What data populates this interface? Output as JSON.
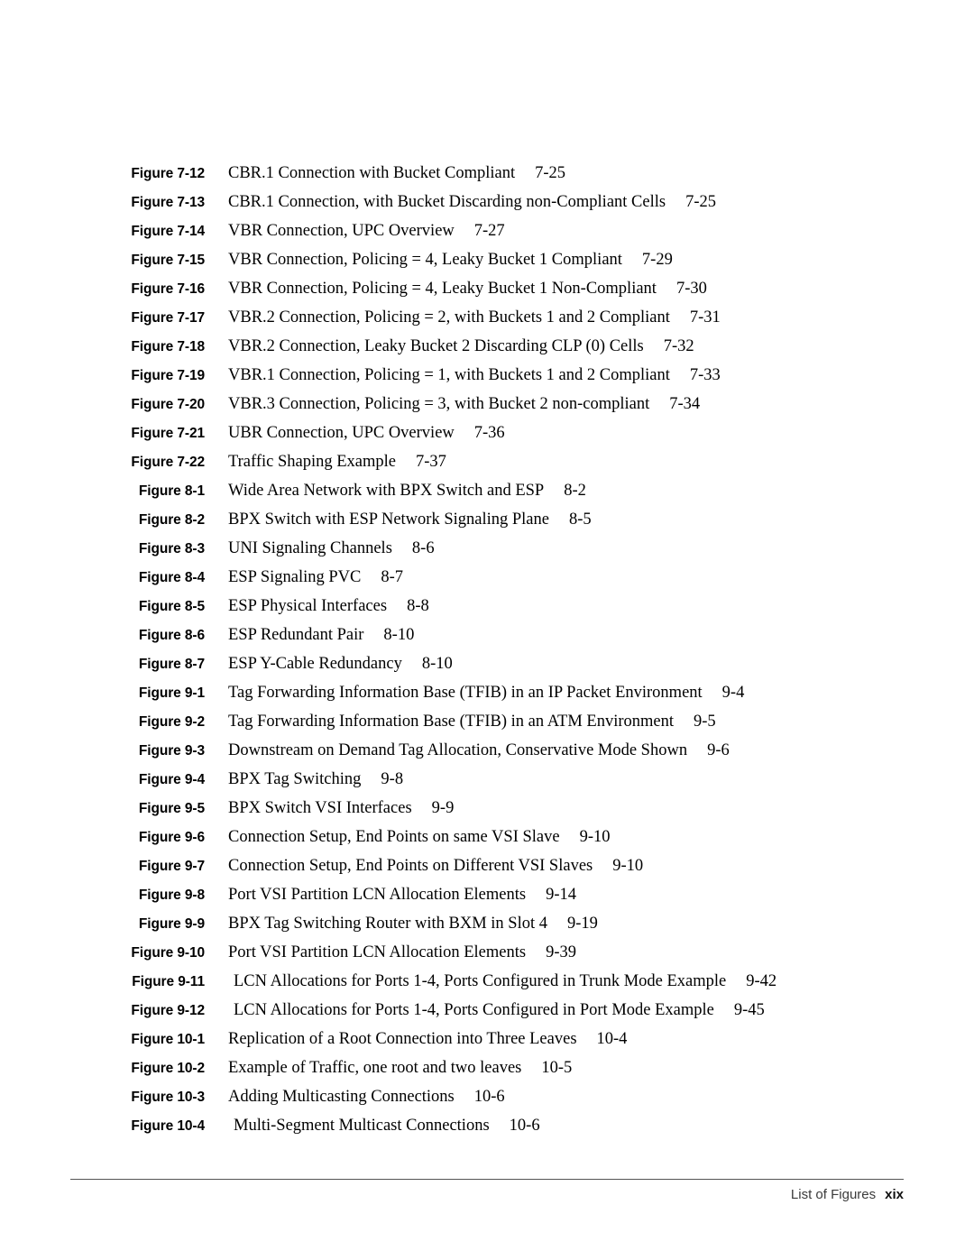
{
  "document": {
    "section_title": "List of Figures",
    "page_number": "xix"
  },
  "entries": [
    {
      "label": "Figure 7-12",
      "description": "CBR.1 Connection with Bucket Compliant",
      "page": "7-25",
      "indent": false
    },
    {
      "label": "Figure 7-13",
      "description": "CBR.1 Connection, with Bucket Discarding non-Compliant Cells",
      "page": "7-25",
      "indent": false
    },
    {
      "label": "Figure 7-14",
      "description": "VBR Connection, UPC Overview",
      "page": "7-27",
      "indent": false
    },
    {
      "label": "Figure 7-15",
      "description": "VBR Connection, Policing = 4, Leaky Bucket 1 Compliant",
      "page": "7-29",
      "indent": false
    },
    {
      "label": "Figure 7-16",
      "description": "VBR Connection, Policing = 4, Leaky Bucket 1 Non-Compliant",
      "page": "7-30",
      "indent": false
    },
    {
      "label": "Figure 7-17",
      "description": "VBR.2 Connection, Policing = 2, with Buckets 1 and 2 Compliant",
      "page": "7-31",
      "indent": false
    },
    {
      "label": "Figure 7-18",
      "description": "VBR.2 Connection, Leaky Bucket 2 Discarding CLP (0) Cells",
      "page": "7-32",
      "indent": false
    },
    {
      "label": "Figure 7-19",
      "description": "VBR.1 Connection, Policing = 1, with Buckets 1 and 2 Compliant",
      "page": "7-33",
      "indent": false
    },
    {
      "label": "Figure 7-20",
      "description": "VBR.3 Connection, Policing = 3, with Bucket 2 non-compliant",
      "page": "7-34",
      "indent": false
    },
    {
      "label": "Figure 7-21",
      "description": "UBR Connection, UPC Overview",
      "page": "7-36",
      "indent": false
    },
    {
      "label": "Figure 7-22",
      "description": "Traffic Shaping Example",
      "page": "7-37",
      "indent": false
    },
    {
      "label": "Figure 8-1",
      "description": "Wide Area Network with BPX Switch and ESP",
      "page": "8-2",
      "indent": false
    },
    {
      "label": "Figure 8-2",
      "description": "BPX Switch with ESP Network Signaling Plane",
      "page": "8-5",
      "indent": false
    },
    {
      "label": "Figure 8-3",
      "description": "UNI Signaling Channels",
      "page": "8-6",
      "indent": false
    },
    {
      "label": "Figure 8-4",
      "description": "ESP Signaling PVC",
      "page": "8-7",
      "indent": false
    },
    {
      "label": "Figure 8-5",
      "description": "ESP Physical Interfaces",
      "page": "8-8",
      "indent": false
    },
    {
      "label": "Figure 8-6",
      "description": "ESP Redundant Pair",
      "page": "8-10",
      "indent": false
    },
    {
      "label": "Figure 8-7",
      "description": "ESP Y-Cable Redundancy",
      "page": "8-10",
      "indent": false
    },
    {
      "label": "Figure 9-1",
      "description": "Tag Forwarding Information Base (TFIB) in an IP Packet Environment",
      "page": "9-4",
      "indent": false
    },
    {
      "label": "Figure 9-2",
      "description": "Tag Forwarding Information Base (TFIB) in an ATM Environment",
      "page": "9-5",
      "indent": false
    },
    {
      "label": "Figure 9-3",
      "description": "Downstream on Demand Tag Allocation, Conservative Mode Shown",
      "page": "9-6",
      "indent": false
    },
    {
      "label": "Figure 9-4",
      "description": "BPX Tag Switching",
      "page": "9-8",
      "indent": false
    },
    {
      "label": "Figure 9-5",
      "description": "BPX Switch VSI Interfaces",
      "page": "9-9",
      "indent": false
    },
    {
      "label": "Figure 9-6",
      "description": "Connection Setup, End Points on same VSI Slave",
      "page": "9-10",
      "indent": false
    },
    {
      "label": "Figure 9-7",
      "description": "Connection Setup, End Points on Different VSI Slaves",
      "page": "9-10",
      "indent": false
    },
    {
      "label": "Figure 9-8",
      "description": "Port VSI Partition LCN Allocation Elements",
      "page": "9-14",
      "indent": false
    },
    {
      "label": "Figure 9-9",
      "description": "BPX Tag Switching Router with BXM in Slot 4",
      "page": "9-19",
      "indent": false
    },
    {
      "label": "Figure 9-10",
      "description": "Port VSI Partition LCN Allocation Elements",
      "page": "9-39",
      "indent": false
    },
    {
      "label": "Figure 9-11",
      "description": "LCN Allocations for Ports 1-4, Ports Configured in Trunk Mode Example",
      "page": "9-42",
      "indent": true
    },
    {
      "label": "Figure 9-12",
      "description": "LCN Allocations for Ports 1-4, Ports Configured in Port Mode Example",
      "page": "9-45",
      "indent": true
    },
    {
      "label": "Figure 10-1",
      "description": "Replication of a Root Connection into Three Leaves",
      "page": "10-4",
      "indent": false
    },
    {
      "label": "Figure 10-2",
      "description": "Example of Traffic, one root and two leaves",
      "page": "10-5",
      "indent": false
    },
    {
      "label": "Figure 10-3",
      "description": "Adding Multicasting Connections",
      "page": "10-6",
      "indent": false
    },
    {
      "label": "Figure 10-4",
      "description": "Multi-Segment Multicast Connections",
      "page": "10-6",
      "indent": true
    }
  ]
}
